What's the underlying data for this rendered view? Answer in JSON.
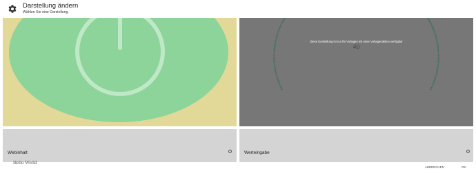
{
  "dialog": {
    "title": "Darstellung ändern",
    "subtitle": "Wählen Sie eine Darstellung",
    "icon": "gear-icon"
  },
  "options": [
    {
      "label": "Webinhalt",
      "preview_text": "Hello World",
      "preview_background": "#e2d898",
      "preview_icon": "power-icon",
      "icon_color": "#8cd49a"
    },
    {
      "label": "Werteingabe",
      "preview_background": "#777777",
      "overlay_message": "Diese Darstellung ist nur für Vorlagen mit einer Vorlagenaktion verfügbar",
      "gauge_value": "40",
      "gauge_color": "#2f6f64"
    }
  ],
  "actions": {
    "cancel_label": "ABBRECHEN",
    "ok_label": "OK"
  },
  "colors": {
    "footer_background": "#d4d4d4",
    "header_text": "#222222"
  }
}
